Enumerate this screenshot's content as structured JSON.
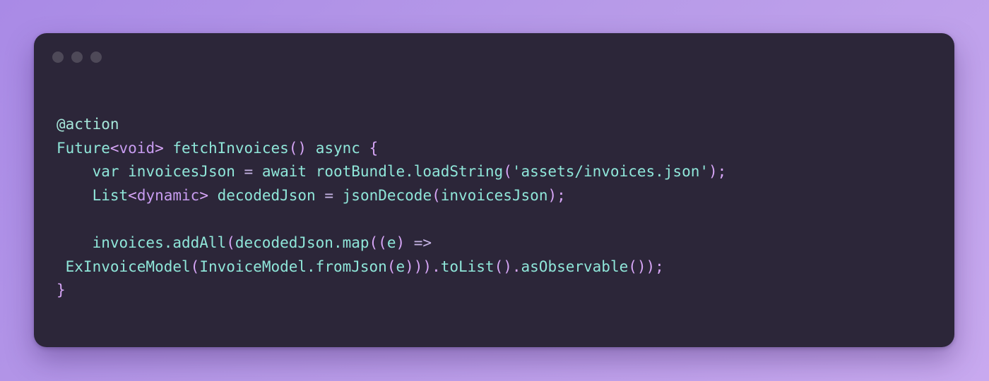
{
  "window": {
    "controls": [
      "close",
      "minimize",
      "maximize"
    ]
  },
  "code": {
    "language": "dart",
    "lines": [
      [
        {
          "t": "@action",
          "c": "annotation"
        }
      ],
      [
        {
          "t": "Future",
          "c": "type"
        },
        {
          "t": "<",
          "c": "punct"
        },
        {
          "t": "void",
          "c": "generic"
        },
        {
          "t": ">",
          "c": "punct"
        },
        {
          "t": " fetchInvoices",
          "c": "ident"
        },
        {
          "t": "()",
          "c": "punct"
        },
        {
          "t": " async ",
          "c": "keyword"
        },
        {
          "t": "{",
          "c": "punct"
        }
      ],
      [
        {
          "t": "    var ",
          "c": "keyword"
        },
        {
          "t": "invoicesJson ",
          "c": "ident"
        },
        {
          "t": "= ",
          "c": "op"
        },
        {
          "t": "await ",
          "c": "keyword"
        },
        {
          "t": "rootBundle.loadString",
          "c": "ident"
        },
        {
          "t": "(",
          "c": "punct"
        },
        {
          "t": "'assets/invoices.json'",
          "c": "string"
        },
        {
          "t": ");",
          "c": "punct"
        }
      ],
      [
        {
          "t": "    List",
          "c": "type"
        },
        {
          "t": "<",
          "c": "punct"
        },
        {
          "t": "dynamic",
          "c": "generic"
        },
        {
          "t": ">",
          "c": "punct"
        },
        {
          "t": " decodedJson ",
          "c": "ident"
        },
        {
          "t": "= ",
          "c": "op"
        },
        {
          "t": "jsonDecode",
          "c": "ident"
        },
        {
          "t": "(",
          "c": "punct"
        },
        {
          "t": "invoicesJson",
          "c": "ident"
        },
        {
          "t": ");",
          "c": "punct"
        }
      ],
      [],
      [
        {
          "t": "    invoices.addAll",
          "c": "ident"
        },
        {
          "t": "(",
          "c": "punct"
        },
        {
          "t": "decodedJson.map",
          "c": "ident"
        },
        {
          "t": "((",
          "c": "punct"
        },
        {
          "t": "e",
          "c": "ident"
        },
        {
          "t": ") ",
          "c": "punct"
        },
        {
          "t": "=>",
          "c": "op"
        }
      ],
      [
        {
          "t": " ExInvoiceModel",
          "c": "type"
        },
        {
          "t": "(",
          "c": "punct"
        },
        {
          "t": "InvoiceModel.fromJson",
          "c": "ident"
        },
        {
          "t": "(",
          "c": "punct"
        },
        {
          "t": "e",
          "c": "ident"
        },
        {
          "t": "))).",
          "c": "punct"
        },
        {
          "t": "toList",
          "c": "ident"
        },
        {
          "t": "().",
          "c": "punct"
        },
        {
          "t": "asObservable",
          "c": "ident"
        },
        {
          "t": "());",
          "c": "punct"
        }
      ],
      [
        {
          "t": "}",
          "c": "punct"
        }
      ]
    ]
  }
}
